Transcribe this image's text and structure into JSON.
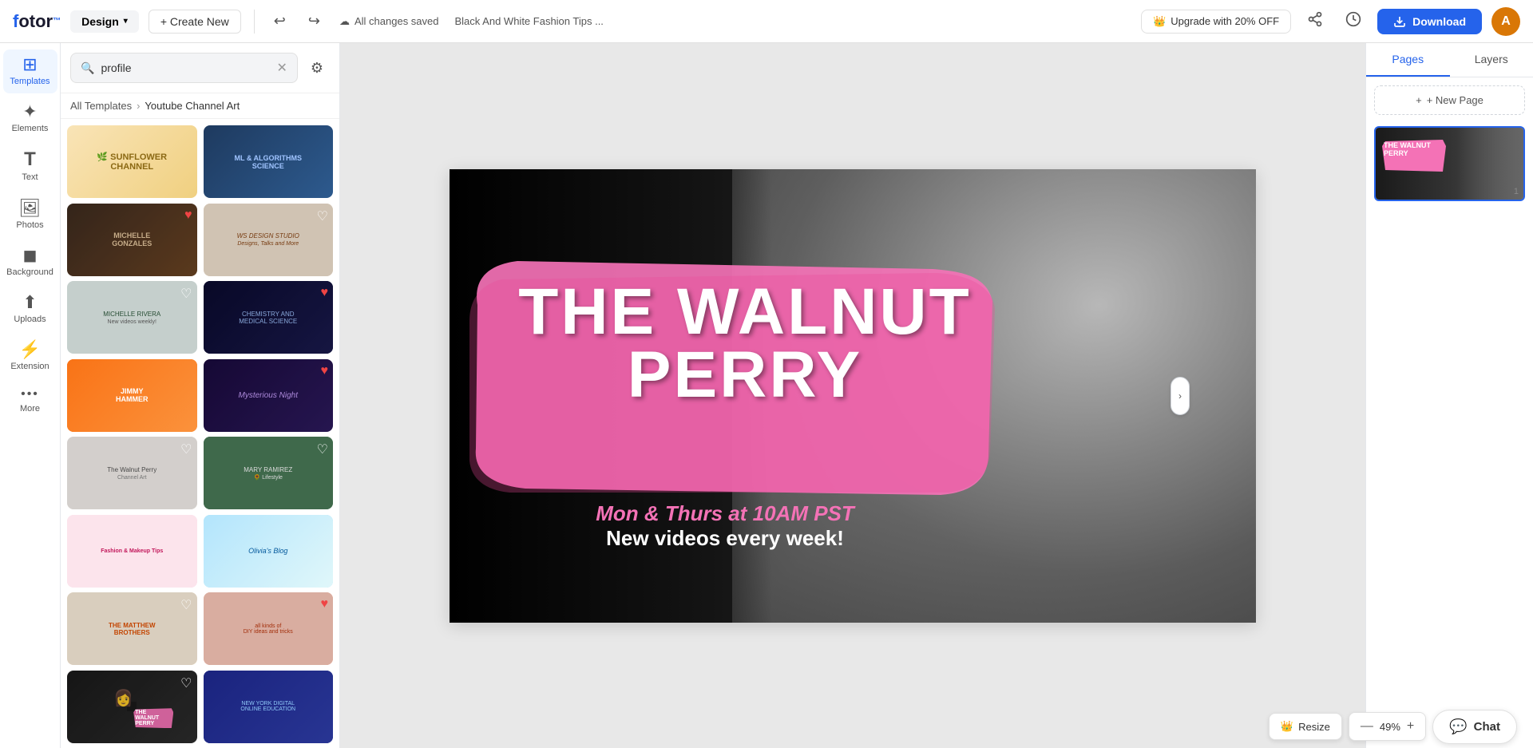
{
  "topbar": {
    "logo": "fotor",
    "design_label": "Design",
    "create_new_label": "+ Create New",
    "saved_status": "All changes saved",
    "doc_title": "Black And White Fashion Tips ...",
    "upgrade_label": "Upgrade with 20% OFF",
    "download_label": "Download",
    "avatar_initials": "A"
  },
  "sidebar": {
    "items": [
      {
        "id": "templates",
        "label": "Templates",
        "icon": "⊞"
      },
      {
        "id": "elements",
        "label": "Elements",
        "icon": "✦"
      },
      {
        "id": "text",
        "label": "Text",
        "icon": "T"
      },
      {
        "id": "photos",
        "label": "Photos",
        "icon": "🖼"
      },
      {
        "id": "background",
        "label": "Background",
        "icon": "◼"
      },
      {
        "id": "uploads",
        "label": "Uploads",
        "icon": "⬆"
      },
      {
        "id": "extension",
        "label": "Extension",
        "icon": "⚡"
      },
      {
        "id": "more",
        "label": "More",
        "icon": "•••"
      }
    ]
  },
  "templates_panel": {
    "search_placeholder": "profile",
    "breadcrumb_root": "All Templates",
    "breadcrumb_current": "Youtube Channel Art",
    "templates": [
      {
        "id": 1,
        "color_class": "tc-1",
        "has_heart": false,
        "heart_active": false
      },
      {
        "id": 2,
        "color_class": "tc-2",
        "has_heart": false,
        "heart_active": false
      },
      {
        "id": 3,
        "color_class": "tc-3",
        "has_heart": true,
        "heart_active": true
      },
      {
        "id": 4,
        "color_class": "tc-4",
        "has_heart": true,
        "heart_active": false
      },
      {
        "id": 5,
        "color_class": "tc-5",
        "has_heart": true,
        "heart_active": false
      },
      {
        "id": 6,
        "color_class": "tc-6",
        "has_heart": true,
        "heart_active": true
      },
      {
        "id": 7,
        "color_class": "tc-7",
        "has_heart": false,
        "heart_active": false
      },
      {
        "id": 8,
        "color_class": "tc-8",
        "has_heart": false,
        "heart_active": false
      },
      {
        "id": 9,
        "color_class": "tc-9",
        "has_heart": true,
        "heart_active": false
      },
      {
        "id": 10,
        "color_class": "tc-10",
        "has_heart": true,
        "heart_active": false
      },
      {
        "id": 11,
        "color_class": "tc-11",
        "has_heart": false,
        "heart_active": false
      },
      {
        "id": 12,
        "color_class": "tc-12",
        "has_heart": false,
        "heart_active": false
      },
      {
        "id": 13,
        "color_class": "tc-13",
        "has_heart": true,
        "heart_active": false
      },
      {
        "id": 14,
        "color_class": "tc-14",
        "has_heart": true,
        "heart_active": true
      },
      {
        "id": 15,
        "color_class": "tc-15",
        "has_heart": true,
        "heart_active": false
      },
      {
        "id": 16,
        "color_class": "tc-16",
        "has_heart": false,
        "heart_active": false
      },
      {
        "id": 17,
        "color_class": "tc-17",
        "has_heart": false,
        "heart_active": false
      },
      {
        "id": 18,
        "color_class": "tc-18",
        "has_heart": false,
        "heart_active": false
      }
    ]
  },
  "canvas": {
    "title_line1": "THE WALNUT",
    "title_line2": "PERRY",
    "subtitle_line1": "Mon & Thurs at 10AM PST",
    "subtitle_line2": "New videos every week!"
  },
  "right_panel": {
    "tab_pages": "Pages",
    "tab_layers": "Layers",
    "new_page_label": "+ New Page",
    "page_number": "1"
  },
  "bottom_bar": {
    "resize_label": "Resize",
    "zoom_level": "49%",
    "zoom_decrease": "—",
    "zoom_increase": "+",
    "chat_label": "Chat"
  }
}
